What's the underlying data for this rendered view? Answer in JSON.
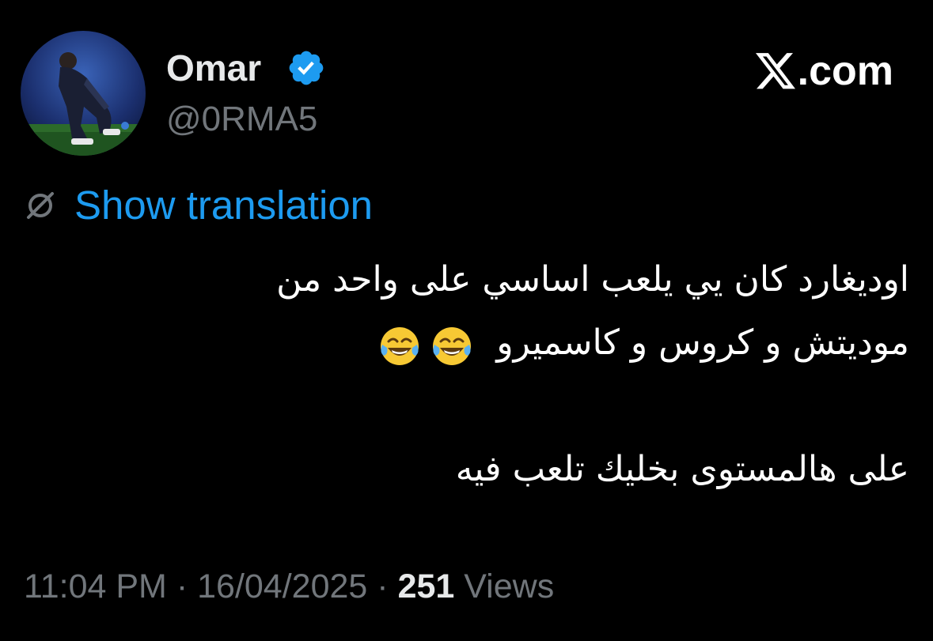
{
  "tweet": {
    "author": {
      "display_name": "Omar",
      "handle": "@0RMA5",
      "verified": true,
      "verified_color": "#1d9bf0"
    },
    "brand": {
      "label": ".com",
      "icon": "x-logo-icon"
    },
    "translate": {
      "label": "Show translation",
      "icon": "globe-slash-icon",
      "color": "#1d9bf0"
    },
    "text": {
      "line1": "اوديغارد كان يي يلعب اساسي على واحد من",
      "line2": "موديتش و كروس و كاسميرو",
      "line2_emoji": [
        "face-with-tears-of-joy-icon",
        "face-with-tears-of-joy-icon"
      ],
      "line3": "على هالمستوى بخليك تلعب فيه"
    },
    "meta": {
      "time": "11:04 PM",
      "separator": "·",
      "date": "16/04/2025",
      "views_count": "251",
      "views_label": "Views"
    }
  }
}
